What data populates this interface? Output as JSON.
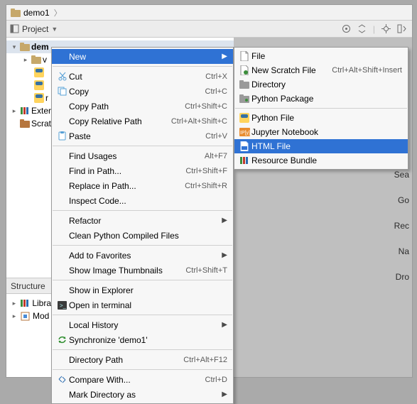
{
  "path": {
    "folder": "demo1"
  },
  "projectBar": {
    "label": "Project"
  },
  "tree": {
    "root": "dem",
    "child1": "v",
    "leafR": "r",
    "extLib": "Exter",
    "scratch": "Scrat"
  },
  "structure": {
    "title": "Structure",
    "row1": "Libra",
    "row2": "Mod"
  },
  "peeks": {
    "p1": "Sea",
    "p2": "Go",
    "p3": "Rec",
    "p4": "Na",
    "p5": "Dro"
  },
  "menu": {
    "new": "New",
    "cut": "Cut",
    "cut_sc": "Ctrl+X",
    "copy": "Copy",
    "copy_sc": "Ctrl+C",
    "copyPath": "Copy Path",
    "copyPath_sc": "Ctrl+Shift+C",
    "copyRel": "Copy Relative Path",
    "copyRel_sc": "Ctrl+Alt+Shift+C",
    "paste": "Paste",
    "paste_sc": "Ctrl+V",
    "findUsages": "Find Usages",
    "findUsages_sc": "Alt+F7",
    "findInPath": "Find in Path...",
    "findInPath_sc": "Ctrl+Shift+F",
    "replaceInPath": "Replace in Path...",
    "replaceInPath_sc": "Ctrl+Shift+R",
    "inspect": "Inspect Code...",
    "refactor": "Refactor",
    "cleanPy": "Clean Python Compiled Files",
    "addFav": "Add to Favorites",
    "thumbs": "Show Image Thumbnails",
    "thumbs_sc": "Ctrl+Shift+T",
    "showExpl": "Show in Explorer",
    "openTerm": "Open in terminal",
    "localHist": "Local History",
    "sync": "Synchronize 'demo1'",
    "dirPath": "Directory Path",
    "dirPath_sc": "Ctrl+Alt+F12",
    "compare": "Compare With...",
    "compare_sc": "Ctrl+D",
    "markDir": "Mark Directory as"
  },
  "submenu": {
    "file": "File",
    "scratch": "New Scratch File",
    "scratch_sc": "Ctrl+Alt+Shift+Insert",
    "directory": "Directory",
    "pyPkg": "Python Package",
    "pyFile": "Python File",
    "jupyter": "Jupyter Notebook",
    "html": "HTML File",
    "resBundle": "Resource Bundle"
  }
}
